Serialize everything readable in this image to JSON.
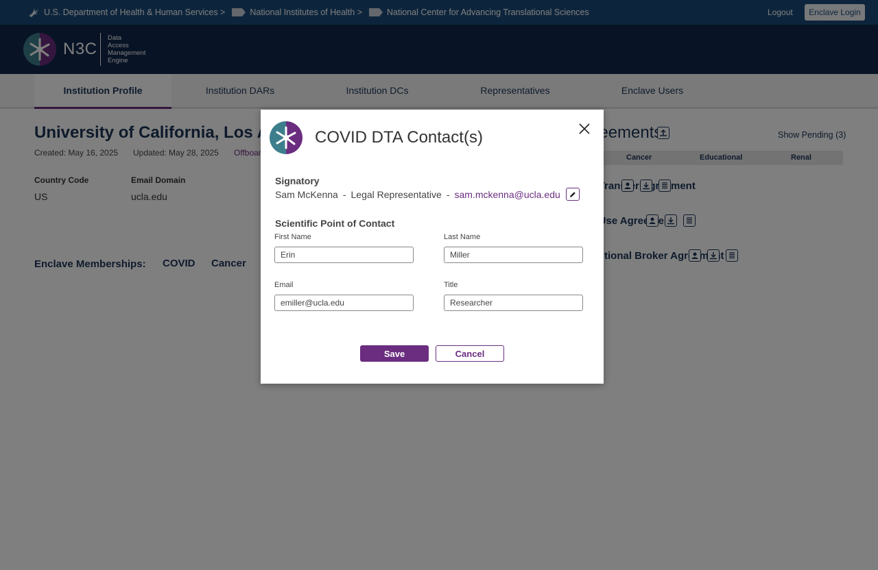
{
  "gov_bar": {
    "crumbs": [
      "U.S. Department of Health & Human Services >",
      "National Institutes of Health >",
      "National Center for Advancing Translational Sciences"
    ],
    "logout_label": "Logout",
    "enclave_login_label": "Enclave Login"
  },
  "header": {
    "brand": "N3C",
    "tagline": [
      "Data",
      "Access",
      "Management",
      "Engine"
    ]
  },
  "tabs": [
    {
      "label": "Institution Profile",
      "active": true
    },
    {
      "label": "Institution DARs",
      "active": false
    },
    {
      "label": "Institution DCs",
      "active": false
    },
    {
      "label": "Representatives",
      "active": false
    },
    {
      "label": "Enclave Users",
      "active": false
    }
  ],
  "profile": {
    "title": "University of California, Los Angeles",
    "created": "Created: May 16, 2025",
    "updated": "Updated: May 28, 2025",
    "offboard_link": "Offboard",
    "country_code_label": "Country Code",
    "country_code_value": "US",
    "email_domain_label": "Email Domain",
    "email_domain_value": "ucla.edu",
    "memberships_label": "Enclave Memberships:",
    "memberships": [
      "COVID",
      "Cancer"
    ]
  },
  "agreements": {
    "title": "Agreements",
    "show_pending": "Show Pending (3)",
    "columns": [
      "Cancer",
      "Educational",
      "Renal"
    ],
    "rows": [
      "Data Transfer Agreement",
      "Data Use Agreement",
      "Institutional Broker Agreement"
    ]
  },
  "modal": {
    "title": "COVID DTA Contact(s)",
    "signatory_heading": "Signatory",
    "signatory_name": "Sam McKenna",
    "signatory_sep": "-",
    "signatory_role": "Legal Representative",
    "signatory_email": "sam.mckenna@ucla.edu",
    "poc_heading": "Scientific Point of Contact",
    "first_name_label": "First Name",
    "first_name_value": "Erin",
    "last_name_label": "Last Name",
    "last_name_value": "Miller",
    "email_label": "Email",
    "email_value": "emiller@ucla.edu",
    "title_label": "Title",
    "title_value": "Researcher",
    "save_label": "Save",
    "cancel_label": "Cancel"
  },
  "colors": {
    "gov_bar": "#1b4a78",
    "header": "#10284c",
    "accent_purple": "#6a2d7f",
    "navy_text": "#1c3556"
  }
}
